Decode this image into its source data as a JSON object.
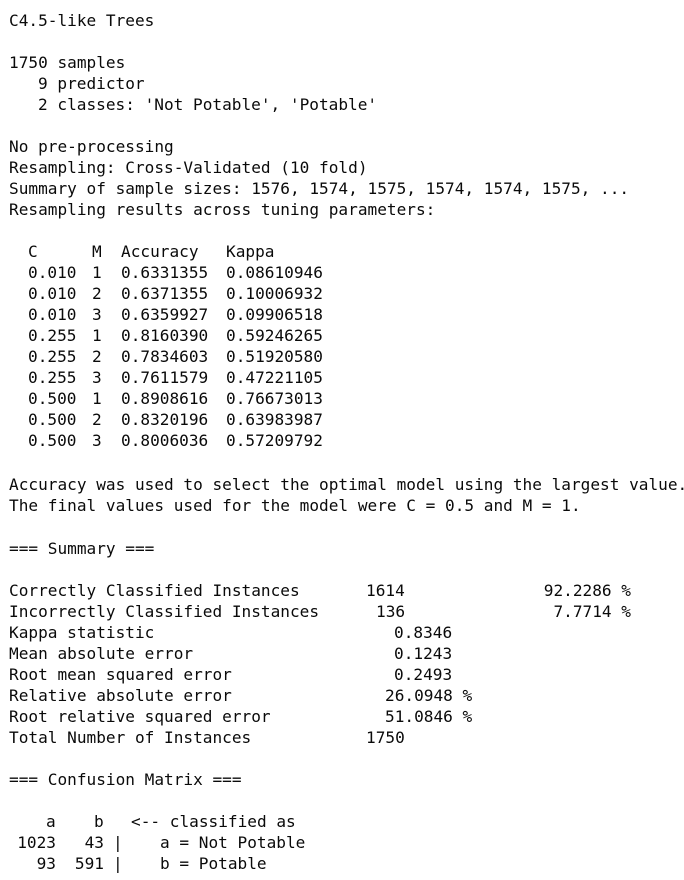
{
  "title": "C4.5-like Trees",
  "samples": "1750 samples",
  "predictors": "9 predictor",
  "classes": "2 classes: 'Not Potable', 'Potable'",
  "preprocessing": "No pre-processing",
  "resampling": "Resampling: Cross-Validated (10 fold)",
  "sample_sizes": "Summary of sample sizes: 1576, 1574, 1575, 1574, 1574, 1575, ...",
  "tuning_header": "Resampling results across tuning parameters:",
  "tuning_table": {
    "columns": [
      "C",
      "M",
      "Accuracy",
      "Kappa"
    ],
    "rows": [
      [
        "0.010",
        "1",
        "0.6331355",
        "0.08610946"
      ],
      [
        "0.010",
        "2",
        "0.6371355",
        "0.10006932"
      ],
      [
        "0.010",
        "3",
        "0.6359927",
        "0.09906518"
      ],
      [
        "0.255",
        "1",
        "0.8160390",
        "0.59246265"
      ],
      [
        "0.255",
        "2",
        "0.7834603",
        "0.51920580"
      ],
      [
        "0.255",
        "3",
        "0.7611579",
        "0.47221105"
      ],
      [
        "0.500",
        "1",
        "0.8908616",
        "0.76673013"
      ],
      [
        "0.500",
        "2",
        "0.8320196",
        "0.63983987"
      ],
      [
        "0.500",
        "3",
        "0.8006036",
        "0.57209792"
      ]
    ]
  },
  "selection_note": "Accuracy was used to select the optimal model using the largest value.",
  "final_values": "The final values used for the model were C = 0.5 and M = 1.",
  "summary_header": "=== Summary ===",
  "summary": {
    "correct_label": "Correctly Classified Instances",
    "correct_count": "1614",
    "correct_pct": "92.2286 %",
    "incorrect_label": "Incorrectly Classified Instances",
    "incorrect_count": "136",
    "incorrect_pct": "7.7714 %",
    "kappa_label": "Kappa statistic",
    "kappa_value": "0.8346",
    "mae_label": "Mean absolute error",
    "mae_value": "0.1243",
    "rmse_label": "Root mean squared error",
    "rmse_value": "0.2493",
    "rae_label": "Relative absolute error",
    "rae_value": "26.0948 %",
    "rrse_label": "Root relative squared error",
    "rrse_value": "51.0846 %",
    "total_label": "Total Number of Instances",
    "total_value": "1750"
  },
  "confusion_header": "=== Confusion Matrix ===",
  "confusion": {
    "col_a": "a",
    "col_b": "b",
    "arrow_label": "<-- classified as",
    "row1_a": "1023",
    "row1_b": "43",
    "row1_label": "a = Not Potable",
    "row2_a": "93",
    "row2_b": "591",
    "row2_label": "b = Potable",
    "separator": "|"
  }
}
